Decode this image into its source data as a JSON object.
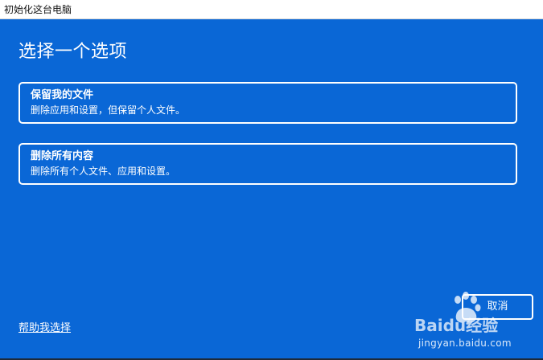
{
  "window": {
    "title": "初始化这台电脑"
  },
  "main": {
    "heading": "选择一个选项",
    "options": [
      {
        "title": "保留我的文件",
        "description": "删除应用和设置，但保留个人文件。"
      },
      {
        "title": "删除所有内容",
        "description": "删除所有个人文件、应用和设置。"
      }
    ],
    "help_link": "帮助我选择",
    "cancel_label": "取消"
  },
  "watermark": {
    "logo_text": "Baidu经验",
    "url": "jingyan.baidu.com"
  },
  "colors": {
    "background": "#0A67D6",
    "text": "#FFFFFF",
    "titlebar": "#FFFFFF"
  }
}
